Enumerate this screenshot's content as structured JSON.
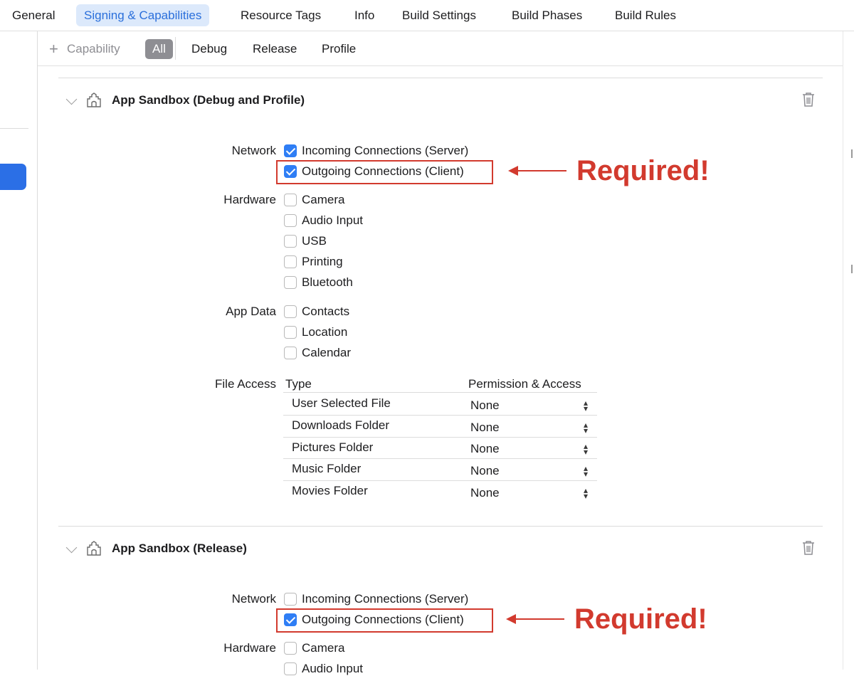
{
  "tabs": [
    {
      "label": "General",
      "active": false
    },
    {
      "label": "Signing & Capabilities",
      "active": true
    },
    {
      "label": "Resource Tags",
      "active": false
    },
    {
      "label": "Info",
      "active": false
    },
    {
      "label": "Build Settings",
      "active": false
    },
    {
      "label": "Build Phases",
      "active": false
    },
    {
      "label": "Build Rules",
      "active": false
    }
  ],
  "filter": {
    "add_symbol": "+",
    "add_label": "Capability",
    "options": [
      "All",
      "Debug",
      "Release",
      "Profile"
    ],
    "selected": "All"
  },
  "sections": [
    {
      "title": "App Sandbox (Debug and Profile)",
      "network": {
        "label": "Network",
        "items": [
          {
            "label": "Incoming Connections (Server)",
            "checked": true
          },
          {
            "label": "Outgoing Connections (Client)",
            "checked": true
          }
        ]
      },
      "hardware": {
        "label": "Hardware",
        "items": [
          {
            "label": "Camera",
            "checked": false
          },
          {
            "label": "Audio Input",
            "checked": false
          },
          {
            "label": "USB",
            "checked": false
          },
          {
            "label": "Printing",
            "checked": false
          },
          {
            "label": "Bluetooth",
            "checked": false
          }
        ]
      },
      "app_data": {
        "label": "App Data",
        "items": [
          {
            "label": "Contacts",
            "checked": false
          },
          {
            "label": "Location",
            "checked": false
          },
          {
            "label": "Calendar",
            "checked": false
          }
        ]
      },
      "file_access": {
        "label": "File Access",
        "columns": [
          "Type",
          "Permission & Access"
        ],
        "rows": [
          {
            "type": "User Selected File",
            "permission": "None"
          },
          {
            "type": "Downloads Folder",
            "permission": "None"
          },
          {
            "type": "Pictures Folder",
            "permission": "None"
          },
          {
            "type": "Music Folder",
            "permission": "None"
          },
          {
            "type": "Movies Folder",
            "permission": "None"
          }
        ]
      }
    },
    {
      "title": "App Sandbox (Release)",
      "network": {
        "label": "Network",
        "items": [
          {
            "label": "Incoming Connections (Server)",
            "checked": false
          },
          {
            "label": "Outgoing Connections (Client)",
            "checked": true
          }
        ]
      },
      "hardware": {
        "label": "Hardware",
        "items": [
          {
            "label": "Camera",
            "checked": false
          },
          {
            "label": "Audio Input",
            "checked": false
          }
        ]
      }
    }
  ],
  "annotation": {
    "text": "Required!",
    "color": "#d23a2e"
  },
  "colors": {
    "accent": "#2f7ef5",
    "selected_tab_bg": "#dce9fb",
    "annotation": "#d23a2e"
  }
}
